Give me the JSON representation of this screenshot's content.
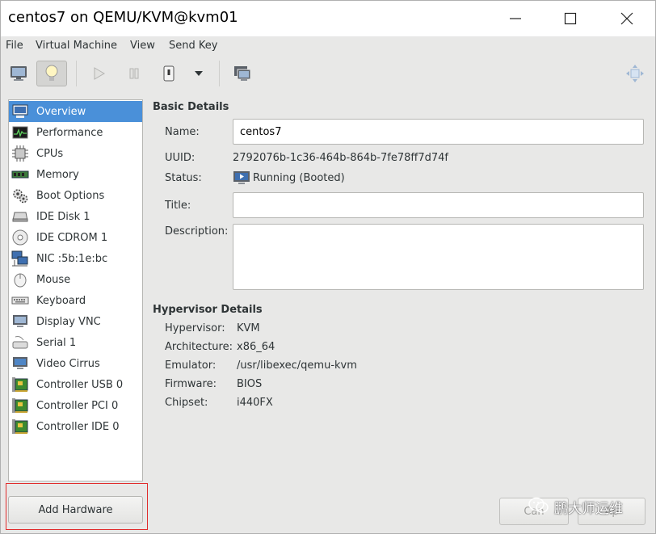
{
  "window": {
    "title": "centos7 on QEMU/KVM@kvm01"
  },
  "menu": [
    "File",
    "Virtual Machine",
    "View",
    "Send Key"
  ],
  "toolbar": {
    "buttons": [
      "console-view",
      "details-view",
      "run",
      "pause",
      "shutdown",
      "shutdown-menu",
      "snapshots",
      "resize-to-vm"
    ]
  },
  "sidebar": {
    "items": [
      {
        "label": "Overview",
        "icon": "computer-icon"
      },
      {
        "label": "Performance",
        "icon": "performance-graph-icon"
      },
      {
        "label": "CPUs",
        "icon": "cpu-chip-icon"
      },
      {
        "label": "Memory",
        "icon": "memory-module-icon"
      },
      {
        "label": "Boot Options",
        "icon": "gears-icon"
      },
      {
        "label": "IDE Disk 1",
        "icon": "hard-disk-icon"
      },
      {
        "label": "IDE CDROM 1",
        "icon": "cdrom-icon"
      },
      {
        "label": "NIC :5b:1e:bc",
        "icon": "network-icon"
      },
      {
        "label": "Mouse",
        "icon": "mouse-icon"
      },
      {
        "label": "Keyboard",
        "icon": "keyboard-icon"
      },
      {
        "label": "Display VNC",
        "icon": "display-icon"
      },
      {
        "label": "Serial 1",
        "icon": "serial-port-icon"
      },
      {
        "label": "Video Cirrus",
        "icon": "video-card-icon"
      },
      {
        "label": "Controller USB 0",
        "icon": "controller-card-icon"
      },
      {
        "label": "Controller PCI 0",
        "icon": "controller-card-icon"
      },
      {
        "label": "Controller IDE 0",
        "icon": "controller-card-icon"
      }
    ],
    "selected": "Overview",
    "add_hardware": "Add Hardware"
  },
  "basic_details": {
    "heading": "Basic Details",
    "name_label": "Name:",
    "name_value": "centos7",
    "uuid_label": "UUID:",
    "uuid_value": "2792076b-1c36-464b-864b-7fe78ff7d74f",
    "status_label": "Status:",
    "status_value": "Running (Booted)",
    "title_label": "Title:",
    "title_value": "",
    "description_label": "Description:",
    "description_value": ""
  },
  "hypervisor_details": {
    "heading": "Hypervisor Details",
    "rows": [
      {
        "label": "Hypervisor:",
        "value": "KVM"
      },
      {
        "label": "Architecture:",
        "value": "x86_64"
      },
      {
        "label": "Emulator:",
        "value": "/usr/libexec/qemu-kvm"
      },
      {
        "label": "Firmware:",
        "value": "BIOS"
      },
      {
        "label": "Chipset:",
        "value": "i440FX"
      }
    ]
  },
  "footer": {
    "cancel_label": "Can",
    "apply_label": "Ap"
  },
  "watermark": {
    "text": "鹏大师运维"
  }
}
